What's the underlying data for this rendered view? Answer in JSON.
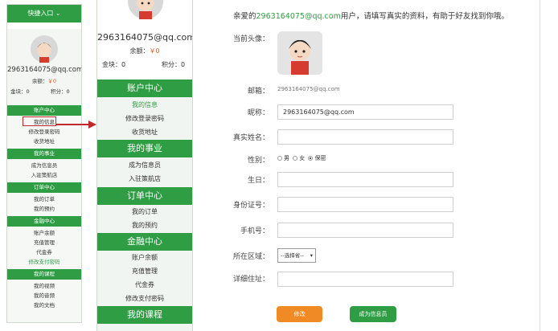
{
  "quick_entry": "快捷入口",
  "profile": {
    "email": "2963164075@qq.com",
    "balance_label": "余额：",
    "balance_value": "￥0",
    "coin": "金块：0",
    "points": "积分：0"
  },
  "nav": [
    {
      "header": "账户中心",
      "items": [
        {
          "label": "我的信息",
          "active": true
        },
        {
          "label": "修改登录密码"
        },
        {
          "label": "收货地址"
        }
      ]
    },
    {
      "header": "我的事业",
      "items": [
        {
          "label": "成为信息员"
        },
        {
          "label": "入驻策航店"
        }
      ]
    },
    {
      "header": "订单中心",
      "items": [
        {
          "label": "我的订单"
        },
        {
          "label": "我的预约"
        }
      ]
    },
    {
      "header": "金融中心",
      "items": [
        {
          "label": "账户余额"
        },
        {
          "label": "充值管理"
        },
        {
          "label": "代金券"
        },
        {
          "label": "修改支付密码"
        }
      ]
    },
    {
      "header": "我的课程",
      "items": [
        {
          "label": "我的视频"
        },
        {
          "label": "我的音频"
        },
        {
          "label": "我的文档"
        }
      ]
    }
  ],
  "form": {
    "welcome_prefix": "亲爱的",
    "welcome_email": "2963164075@qq.com",
    "welcome_suffix": "用户，请填写真实的资料，有助于好友找到你哦。",
    "avatar_label": "当前头像：",
    "email_label": "邮箱：",
    "email_value": "2963164075@qq.com",
    "nickname_label": "昵称：",
    "nickname_value": "2963164075@qq.com",
    "realname_label": "真实姓名：",
    "gender_label": "性别：",
    "gender_male": "男",
    "gender_female": "女",
    "gender_secret": "保密",
    "birthday_label": "生日：",
    "idcard_label": "身份证号：",
    "phone_label": "手机号：",
    "region_label": "所在区域：",
    "region_select": "--选择省--",
    "address_label": "详细住址：",
    "save_button": "修改",
    "become_button": "成为信息员"
  },
  "colors": {
    "accent": "#2e9d44",
    "highlight": "#c0282c",
    "orange": "#f08a24"
  }
}
